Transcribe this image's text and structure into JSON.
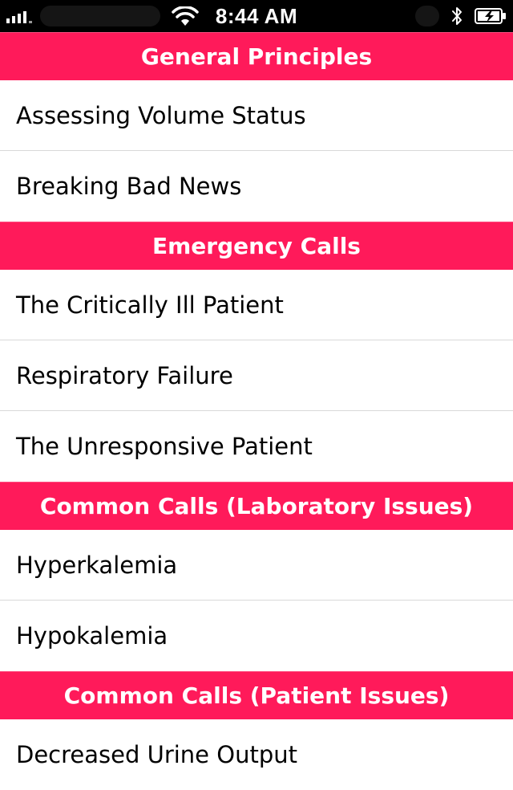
{
  "status_bar": {
    "time": "8:44 AM",
    "signal_level": 4,
    "icons": [
      "signal-bars-icon",
      "wifi-icon",
      "bluetooth-icon",
      "battery-charging-icon"
    ]
  },
  "colors": {
    "section_header_bg": "#ff1a5a",
    "section_header_text": "#ffffff"
  },
  "sections": [
    {
      "title": "General Principles",
      "items": [
        "Assessing Volume Status",
        "Breaking Bad News"
      ]
    },
    {
      "title": "Emergency Calls",
      "items": [
        "The Critically Ill Patient",
        "Respiratory Failure",
        "The Unresponsive Patient"
      ]
    },
    {
      "title": "Common Calls (Laboratory Issues)",
      "items": [
        "Hyperkalemia",
        "Hypokalemia"
      ]
    },
    {
      "title": "Common Calls (Patient Issues)",
      "items": [
        "Decreased Urine Output"
      ]
    }
  ]
}
